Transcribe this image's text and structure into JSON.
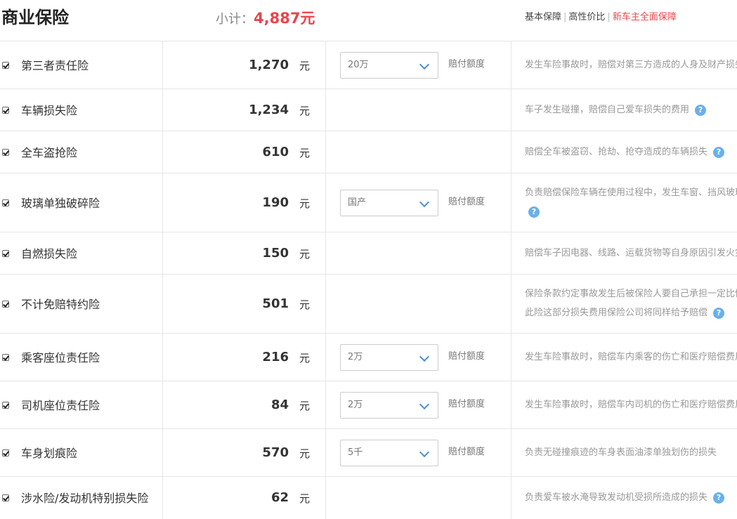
{
  "header": {
    "title": "商业保险",
    "subtotal_label": "小计：",
    "subtotal_amount": "4,887元",
    "plans": [
      "基本保障",
      "高性价比",
      "新车主全面保障"
    ]
  },
  "rows": [
    {
      "name": "第三者责任险",
      "price": "1,270",
      "unit": "元",
      "select": "20万",
      "coverage_label": "赔付额度",
      "desc": "发生车险事故时，赔偿对第三方造成的人身及财产损失"
    },
    {
      "name": "车辆损失险",
      "price": "1,234",
      "unit": "元",
      "desc": "车子发生碰撞，赔偿自己爱车损失的费用",
      "help": "?"
    },
    {
      "name": "全车盗抢险",
      "price": "610",
      "unit": "元",
      "desc": "赔偿全车被盗窃、抢劫、抢夺造成的车辆损失",
      "help": "?"
    },
    {
      "name": "玻璃单独破碎险",
      "price": "190",
      "unit": "元",
      "select": "国产",
      "coverage_label": "赔付额度",
      "desc": "负责赔偿保险车辆在使用过程中，发生车窗、挡风玻璃单独破碎的损失",
      "help": "?"
    },
    {
      "name": "自燃损失险",
      "price": "150",
      "unit": "元",
      "desc": "赔偿车子因电器、线路、运载货物等自身原因引发火灾的损失"
    },
    {
      "name": "不计免赔特约险",
      "price": "501",
      "unit": "元",
      "desc": "保险条款约定事故发生后被保险人要自己承担一定比例的损失",
      "desc2": "此险这部分损失费用保险公司将同样给予赔偿",
      "help": "?"
    },
    {
      "name": "乘客座位责任险",
      "price": "216",
      "unit": "元",
      "select": "2万",
      "coverage_label": "赔付额度",
      "desc": "发生车险事故时，赔偿车内乘客的伤亡和医疗赔偿费用"
    },
    {
      "name": "司机座位责任险",
      "price": "84",
      "unit": "元",
      "select": "2万",
      "coverage_label": "赔付额度",
      "desc": "发生车险事故时，赔偿车内司机的伤亡和医疗赔偿费用"
    },
    {
      "name": "车身划痕险",
      "price": "570",
      "unit": "元",
      "select": "5千",
      "coverage_label": "赔付额度",
      "desc": "负责无碰撞痕迹的车身表面油漆单独划伤的损失"
    },
    {
      "name": "涉水险/发动机特别损失险",
      "price": "62",
      "unit": "元",
      "desc": "负责爱车被水淹导致发动机受损所造成的损失",
      "help": "?"
    }
  ]
}
